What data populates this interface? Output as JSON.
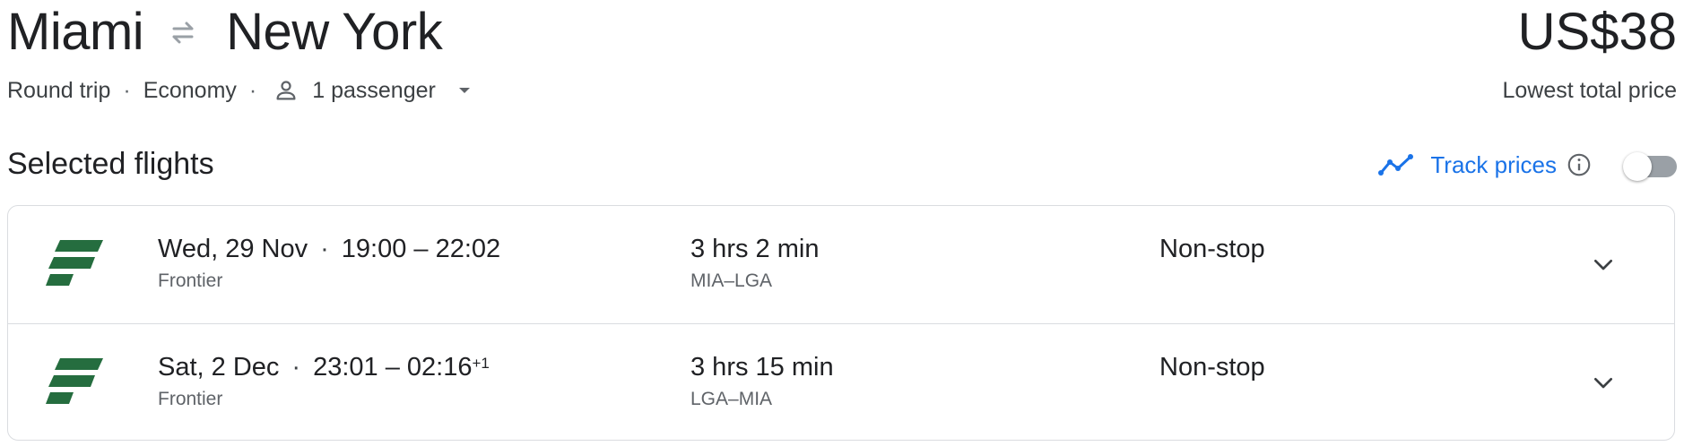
{
  "header": {
    "origin": "Miami",
    "destination": "New York",
    "swap_icon": "swap-arrows-icon",
    "price": "US$38",
    "price_caption": "Lowest total price"
  },
  "trip_options": {
    "trip_type": "Round trip",
    "separator": "·",
    "cabin": "Economy",
    "passengers": "1 passenger"
  },
  "section": {
    "title": "Selected flights",
    "track_label": "Track prices",
    "track_enabled": false
  },
  "flights": [
    {
      "date": "Wed, 29 Nov",
      "time_range": "19:00 – 22:02",
      "day_offset": "",
      "airline": "Frontier",
      "duration": "3 hrs 2 min",
      "airports": "MIA–LGA",
      "stops": "Non-stop"
    },
    {
      "date": "Sat, 2 Dec",
      "time_range": "23:01 – 02:16",
      "day_offset": "+1",
      "airline": "Frontier",
      "duration": "3 hrs 15 min",
      "airports": "LGA–MIA",
      "stops": "Non-stop"
    }
  ],
  "colors": {
    "accent_blue": "#1a73e8",
    "frontier_green": "#256d3f",
    "text_primary": "#202124",
    "text_secondary": "#5f6368",
    "divider": "#dadce0"
  }
}
